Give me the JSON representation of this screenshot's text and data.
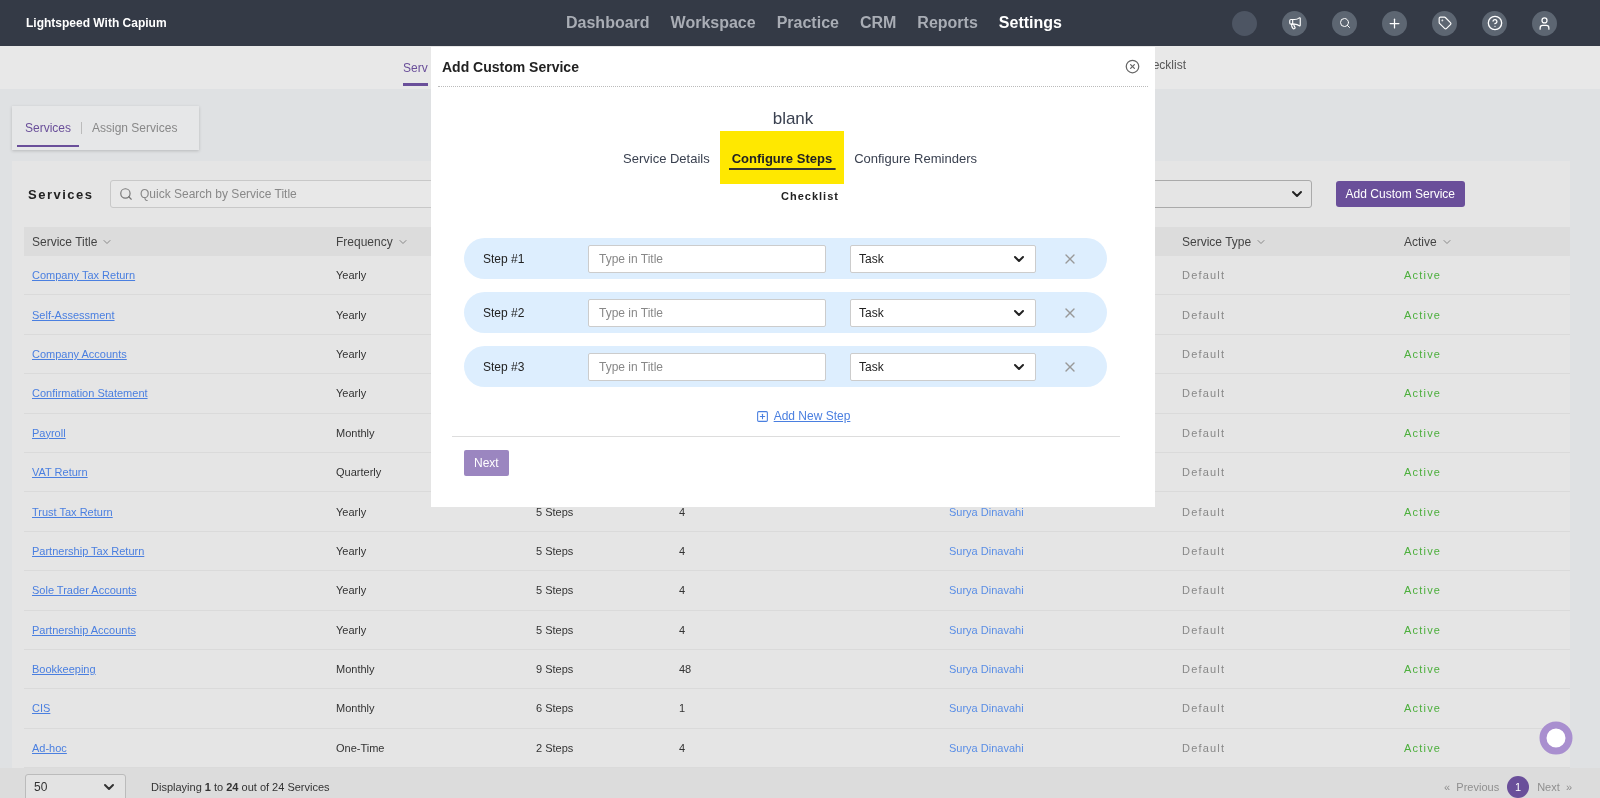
{
  "app": {
    "title": "Lightspeed With Capium"
  },
  "nav": [
    {
      "label": "Dashboard",
      "selected": false
    },
    {
      "label": "Workspace",
      "selected": false
    },
    {
      "label": "Practice",
      "selected": false
    },
    {
      "label": "CRM",
      "selected": false
    },
    {
      "label": "Reports",
      "selected": false
    },
    {
      "label": "Settings",
      "selected": true
    }
  ],
  "nav_icons": [
    {
      "kind": "avatar"
    },
    {
      "kind": "megaphone"
    },
    {
      "kind": "search"
    },
    {
      "kind": "plus"
    },
    {
      "kind": "tag"
    },
    {
      "kind": "help"
    },
    {
      "kind": "user"
    }
  ],
  "sub_tabs": [
    {
      "label": "Serv",
      "selected": true
    },
    {
      "label": "ecklist",
      "selected": false
    }
  ],
  "section_tabs": [
    {
      "label": "Services",
      "selected": true
    },
    {
      "label": "Assign Services",
      "selected": false
    }
  ],
  "services": {
    "heading": "Services",
    "search": {
      "placeholder": "Quick Search by Service Title"
    },
    "add_button": "Add Custom Service"
  },
  "table": {
    "columns": [
      "Service Title",
      "Frequency",
      "",
      "",
      "",
      "Service Type",
      "Active"
    ],
    "rows": [
      {
        "title": "Company Tax Return",
        "frequency": "Yearly",
        "type": "Default",
        "status": "Active"
      },
      {
        "title": "Self-Assessment",
        "frequency": "Yearly",
        "type": "Default",
        "status": "Active"
      },
      {
        "title": "Company Accounts",
        "frequency": "Yearly",
        "type": "Default",
        "status": "Active"
      },
      {
        "title": "Confirmation Statement",
        "frequency": "Yearly",
        "type": "Default",
        "status": "Active"
      },
      {
        "title": "Payroll",
        "frequency": "Monthly",
        "type": "Default",
        "status": "Active"
      },
      {
        "title": "VAT Return",
        "frequency": "Quarterly",
        "type": "Default",
        "status": "Active"
      },
      {
        "title": "Trust Tax Return",
        "frequency": "Yearly",
        "steps": "5 Steps",
        "count": "4",
        "owner": "Surya Dinavahi",
        "type": "Default",
        "status": "Active"
      },
      {
        "title": "Partnership Tax Return",
        "frequency": "Yearly",
        "steps": "5 Steps",
        "count": "4",
        "owner": "Surya Dinavahi",
        "type": "Default",
        "status": "Active"
      },
      {
        "title": "Sole Trader Accounts",
        "frequency": "Yearly",
        "steps": "5 Steps",
        "count": "4",
        "owner": "Surya Dinavahi",
        "type": "Default",
        "status": "Active"
      },
      {
        "title": "Partnership Accounts",
        "frequency": "Yearly",
        "steps": "5 Steps",
        "count": "4",
        "owner": "Surya Dinavahi",
        "type": "Default",
        "status": "Active"
      },
      {
        "title": "Bookkeeping",
        "frequency": "Monthly",
        "steps": "9 Steps",
        "count": "48",
        "owner": "Surya Dinavahi",
        "type": "Default",
        "status": "Active"
      },
      {
        "title": "CIS",
        "frequency": "Monthly",
        "steps": "6 Steps",
        "count": "1",
        "owner": "Surya Dinavahi",
        "type": "Default",
        "status": "Active"
      },
      {
        "title": "Ad-hoc",
        "frequency": "One-Time",
        "steps": "2 Steps",
        "count": "4",
        "owner": "Surya Dinavahi",
        "type": "Default",
        "status": "Active"
      }
    ]
  },
  "footer": {
    "page_size": "50",
    "summary": "Displaying **1** to **24** out of 24 Services",
    "prev_icon": "«",
    "prev": "Previous",
    "prev_disabled": true,
    "pages": [
      {
        "label": "1",
        "selected": true
      }
    ],
    "next": "Next",
    "next_icon": "»",
    "next_disabled": true
  },
  "modal": {
    "title": "Add Custom Service",
    "name": "blank",
    "tabs": [
      {
        "label": "Service Details",
        "selected": false
      },
      {
        "label": "Configure Steps",
        "selected": true
      },
      {
        "label": "Configure Reminders",
        "selected": false
      },
      {
        "label": "Checklist",
        "selected": false
      }
    ],
    "steps": [
      {
        "label": "Step #1",
        "placeholder": "Type in Title",
        "type": "Task"
      },
      {
        "label": "Step #2",
        "placeholder": "Type in Title",
        "type": "Task"
      },
      {
        "label": "Step #3",
        "placeholder": "Type in Title",
        "type": "Task"
      }
    ],
    "add_step": "Add New Step",
    "next": "Next"
  }
}
